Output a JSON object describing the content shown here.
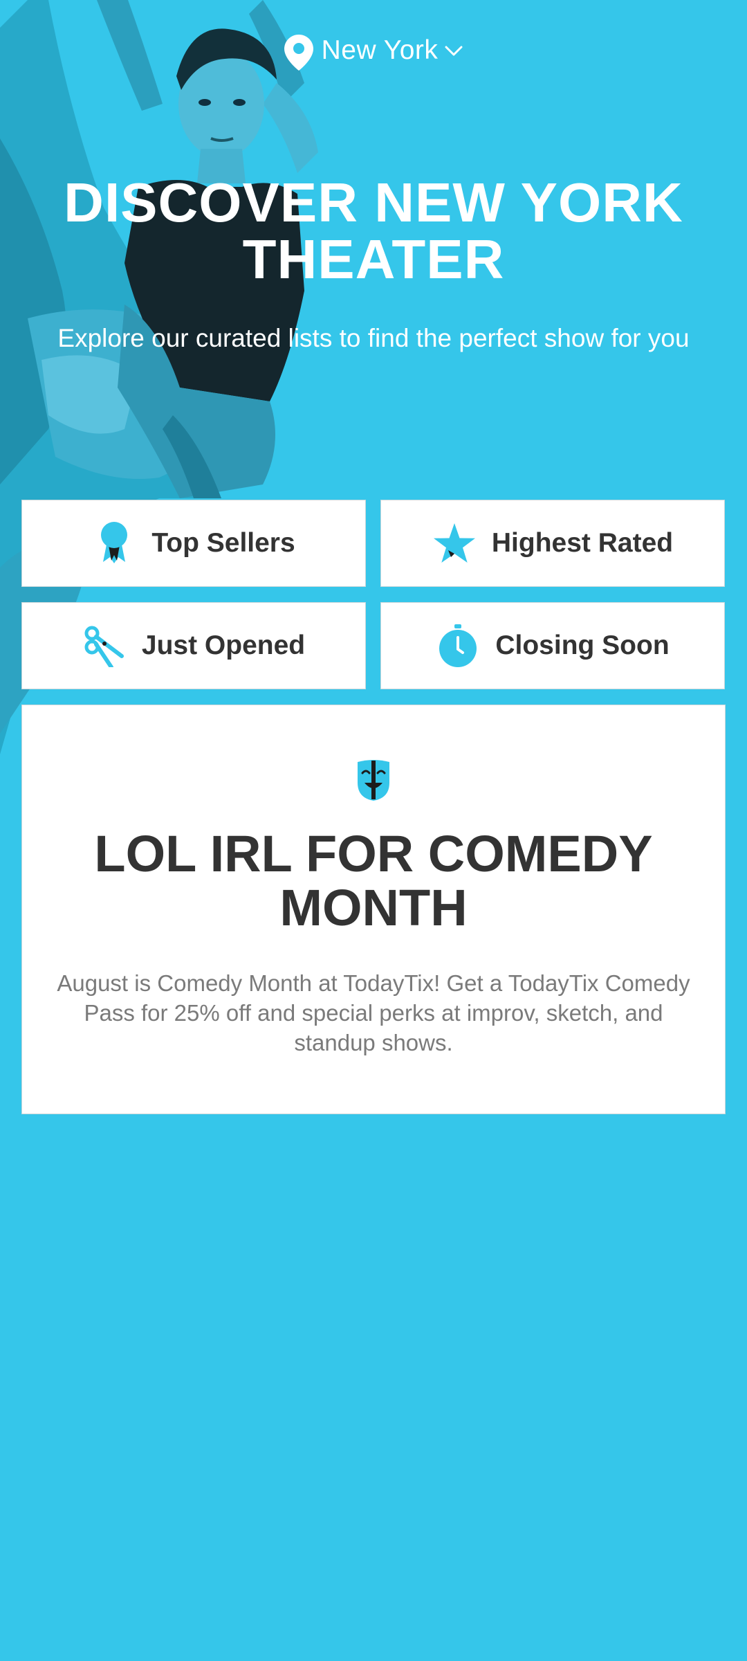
{
  "location": {
    "city": "New York"
  },
  "hero": {
    "title": "DISCOVER NEW YORK THEATER",
    "subtitle": "Explore our curated lists to find the perfect show for you"
  },
  "categories": [
    {
      "label": "Top Sellers",
      "icon": "ribbon-award-icon"
    },
    {
      "label": "Highest Rated",
      "icon": "star-icon"
    },
    {
      "label": "Just Opened",
      "icon": "scissors-icon"
    },
    {
      "label": "Closing Soon",
      "icon": "stopwatch-icon"
    }
  ],
  "promo": {
    "icon": "comedy-mask-icon",
    "title": "LOL IRL FOR COMEDY MONTH",
    "description": "August is Comedy Month at TodayTix! Get a TodayTix Comedy Pass for 25% off and special perks at improv, sketch, and standup shows."
  },
  "colors": {
    "brand": "#35c6ea",
    "card": "#ffffff",
    "text_dark": "#333333",
    "text_muted": "#7a7a7a"
  }
}
